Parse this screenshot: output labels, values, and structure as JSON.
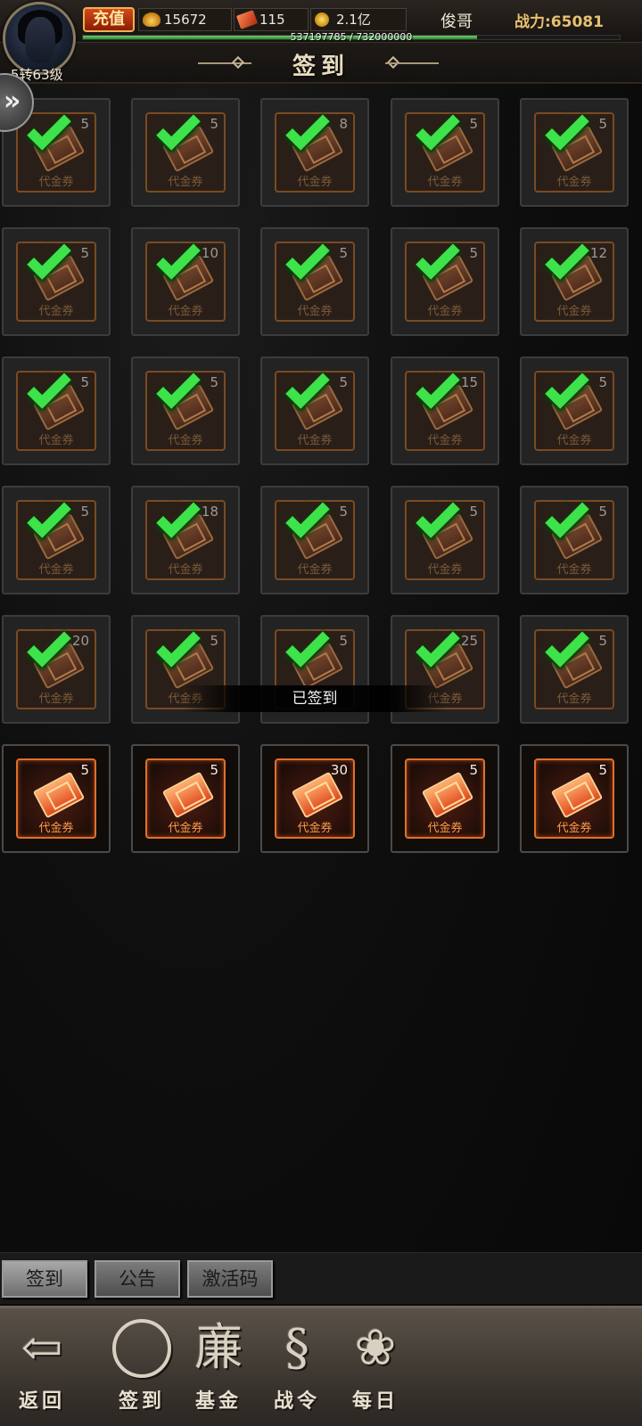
{
  "header": {
    "level_text": "5转63级",
    "recharge_label": "充值",
    "gold": "15672",
    "tickets": "115",
    "coins": "2.1亿",
    "player_name": "俊哥",
    "power": "战力:65081",
    "exp_text": "537197785 / 732000000",
    "exp_fraction": 0.734
  },
  "page": {
    "title": "签到"
  },
  "toast": "已签到",
  "rewards": [
    {
      "count": "5",
      "label": "代金券",
      "claimed": true
    },
    {
      "count": "5",
      "label": "代金券",
      "claimed": true
    },
    {
      "count": "8",
      "label": "代金券",
      "claimed": true
    },
    {
      "count": "5",
      "label": "代金券",
      "claimed": true
    },
    {
      "count": "5",
      "label": "代金券",
      "claimed": true
    },
    {
      "count": "5",
      "label": "代金券",
      "claimed": true
    },
    {
      "count": "10",
      "label": "代金券",
      "claimed": true
    },
    {
      "count": "5",
      "label": "代金券",
      "claimed": true
    },
    {
      "count": "5",
      "label": "代金券",
      "claimed": true
    },
    {
      "count": "12",
      "label": "代金券",
      "claimed": true
    },
    {
      "count": "5",
      "label": "代金券",
      "claimed": true
    },
    {
      "count": "5",
      "label": "代金券",
      "claimed": true
    },
    {
      "count": "5",
      "label": "代金券",
      "claimed": true
    },
    {
      "count": "15",
      "label": "代金券",
      "claimed": true
    },
    {
      "count": "5",
      "label": "代金券",
      "claimed": true
    },
    {
      "count": "5",
      "label": "代金券",
      "claimed": true
    },
    {
      "count": "18",
      "label": "代金券",
      "claimed": true
    },
    {
      "count": "5",
      "label": "代金券",
      "claimed": true
    },
    {
      "count": "5",
      "label": "代金券",
      "claimed": true
    },
    {
      "count": "5",
      "label": "代金券",
      "claimed": true
    },
    {
      "count": "20",
      "label": "代金券",
      "claimed": true
    },
    {
      "count": "5",
      "label": "代金券",
      "claimed": true
    },
    {
      "count": "5",
      "label": "代金券",
      "claimed": true
    },
    {
      "count": "25",
      "label": "代金券",
      "claimed": true
    },
    {
      "count": "5",
      "label": "代金券",
      "claimed": true
    },
    {
      "count": "5",
      "label": "代金券",
      "claimed": false
    },
    {
      "count": "5",
      "label": "代金券",
      "claimed": false
    },
    {
      "count": "30",
      "label": "代金券",
      "claimed": false
    },
    {
      "count": "5",
      "label": "代金券",
      "claimed": false
    },
    {
      "count": "5",
      "label": "代金券",
      "claimed": false
    }
  ],
  "subtabs": [
    "签到",
    "公告",
    "激活码"
  ],
  "nav": [
    {
      "label": "返回",
      "icon": "back-arrow-icon"
    },
    {
      "label": "签到",
      "icon": "sign-in-brush-icon"
    },
    {
      "label": "基金",
      "icon": "fund-icon"
    },
    {
      "label": "战令",
      "icon": "battle-pass-scroll-icon"
    },
    {
      "label": "每日",
      "icon": "daily-icon"
    }
  ]
}
